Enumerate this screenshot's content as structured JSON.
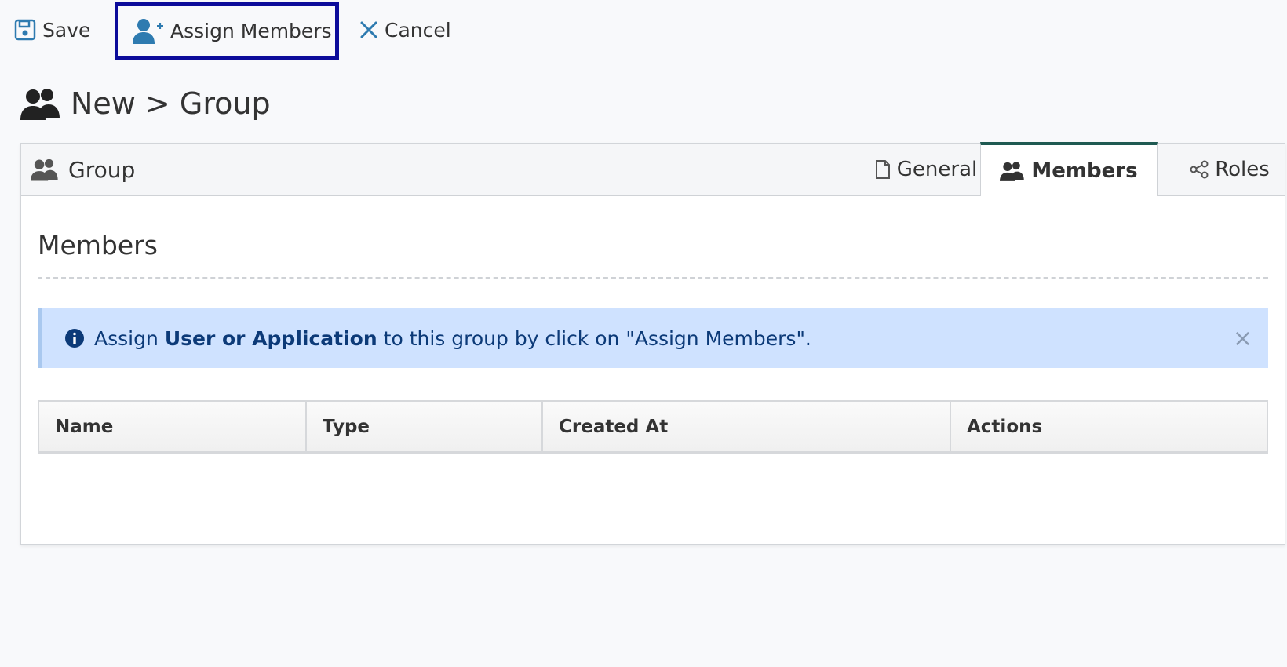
{
  "toolbar": {
    "save_label": "Save",
    "assign_label": "Assign Members",
    "cancel_label": "Cancel"
  },
  "page": {
    "title": "New > Group"
  },
  "panel": {
    "title": "Group",
    "tabs": [
      {
        "label": "General",
        "icon": "file-icon"
      },
      {
        "label": "Members",
        "icon": "users-icon",
        "active": true
      },
      {
        "label": "Roles",
        "icon": "share-icon"
      }
    ]
  },
  "members": {
    "section_title": "Members",
    "alert": {
      "prefix": "Assign",
      "strong": "User or Application",
      "suffix": "to this group by click on \"Assign Members\".",
      "close": "×"
    },
    "table": {
      "columns": [
        "Name",
        "Type",
        "Created At",
        "Actions"
      ],
      "rows": []
    }
  },
  "colors": {
    "accent": "#2e7bb0",
    "tab_active": "#1f5a52",
    "highlight_border": "#0c0c9a",
    "alert_bg": "#cfe2ff",
    "alert_text": "#0c3a78"
  }
}
